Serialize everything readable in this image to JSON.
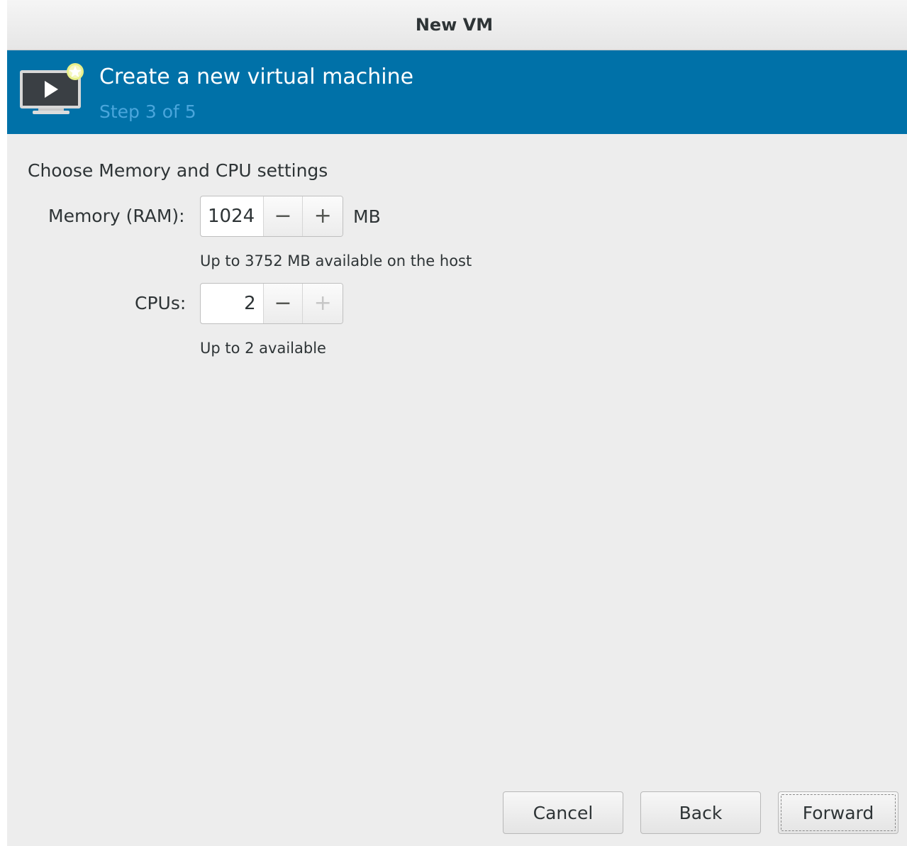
{
  "window": {
    "title": "New VM"
  },
  "banner": {
    "title": "Create a new virtual machine",
    "step": "Step 3 of 5",
    "icon": "new-vm-monitor-icon",
    "background_color": "#0071a8",
    "step_color": "#4aa6dc"
  },
  "main": {
    "heading": "Choose Memory and CPU settings",
    "memory": {
      "label": "Memory (RAM):",
      "value": "1024",
      "unit": "MB",
      "hint": "Up to 3752 MB available on the host",
      "minus": "−",
      "plus": "+"
    },
    "cpus": {
      "label": "CPUs:",
      "value": "2",
      "hint": "Up to 2 available",
      "minus": "−",
      "plus": "+",
      "plus_disabled": true
    }
  },
  "footer": {
    "cancel_label": "Cancel",
    "back_label": "Back",
    "forward_label": "Forward"
  }
}
